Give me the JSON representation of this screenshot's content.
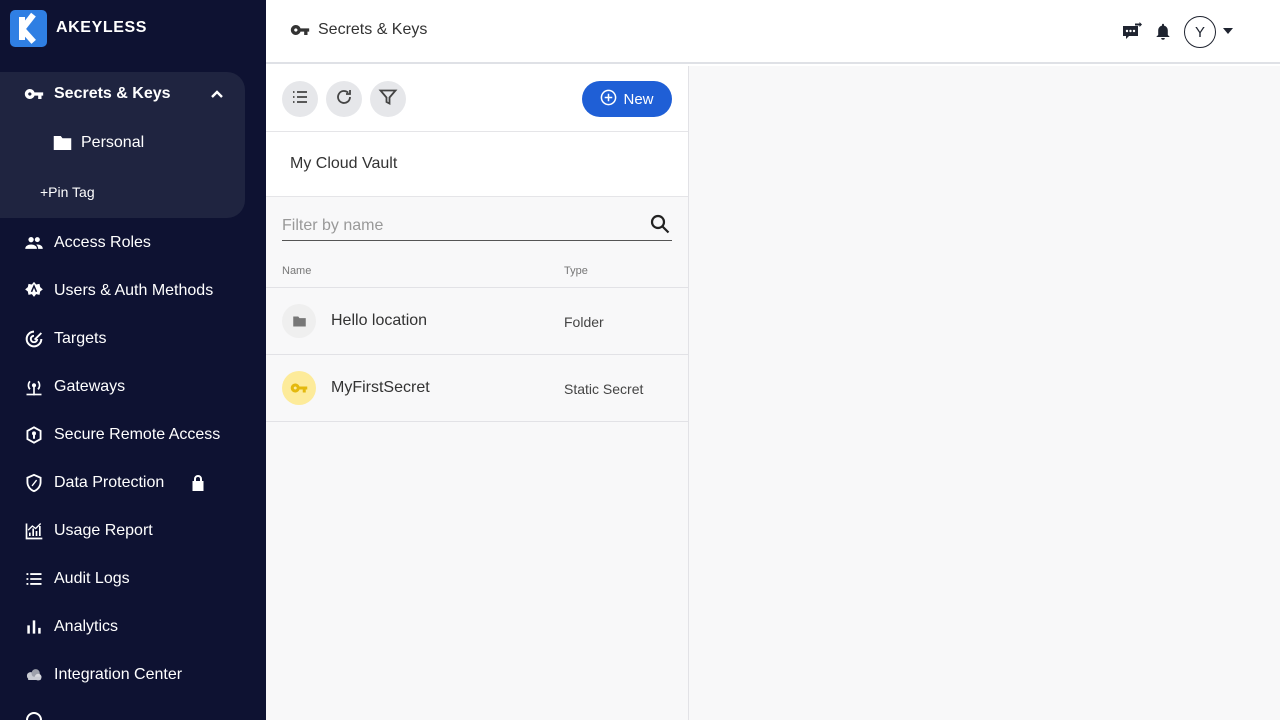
{
  "brand": {
    "name": "AKEYLESS"
  },
  "sidebar": {
    "group": {
      "label": "Secrets & Keys",
      "sub_item": "Personal",
      "pin_tag": "+Pin Tag"
    },
    "items": [
      {
        "label": "Access Roles",
        "icon": "people-icon"
      },
      {
        "label": "Users & Auth Methods",
        "icon": "badge-icon"
      },
      {
        "label": "Targets",
        "icon": "target-icon"
      },
      {
        "label": "Gateways",
        "icon": "gateway-icon"
      },
      {
        "label": "Secure Remote Access",
        "icon": "secure-access-icon"
      },
      {
        "label": "Data Protection",
        "icon": "shield-icon",
        "locked": true
      },
      {
        "label": "Usage Report",
        "icon": "usage-chart-icon"
      },
      {
        "label": "Audit Logs",
        "icon": "list-icon"
      },
      {
        "label": "Analytics",
        "icon": "bar-chart-icon"
      },
      {
        "label": "Integration Center",
        "icon": "cloud-icon"
      }
    ]
  },
  "header": {
    "title": "Secrets & Keys",
    "avatar_initial": "Y"
  },
  "panel": {
    "new_label": "New",
    "vault_name": "My Cloud Vault",
    "filter_placeholder": "Filter by name",
    "columns": {
      "name": "Name",
      "type": "Type"
    },
    "rows": [
      {
        "name": "Hello location",
        "type": "Folder",
        "icon": "folder-icon"
      },
      {
        "name": "MyFirstSecret",
        "type": "Static Secret",
        "icon": "key-icon"
      }
    ]
  },
  "colors": {
    "sidebar_bg": "#0e1232",
    "sidebar_group_bg": "#1f2440",
    "accent": "#1f5fd6",
    "brand_logo": "#2f7fe3",
    "secret_icon_bg": "#fdeb9a"
  }
}
